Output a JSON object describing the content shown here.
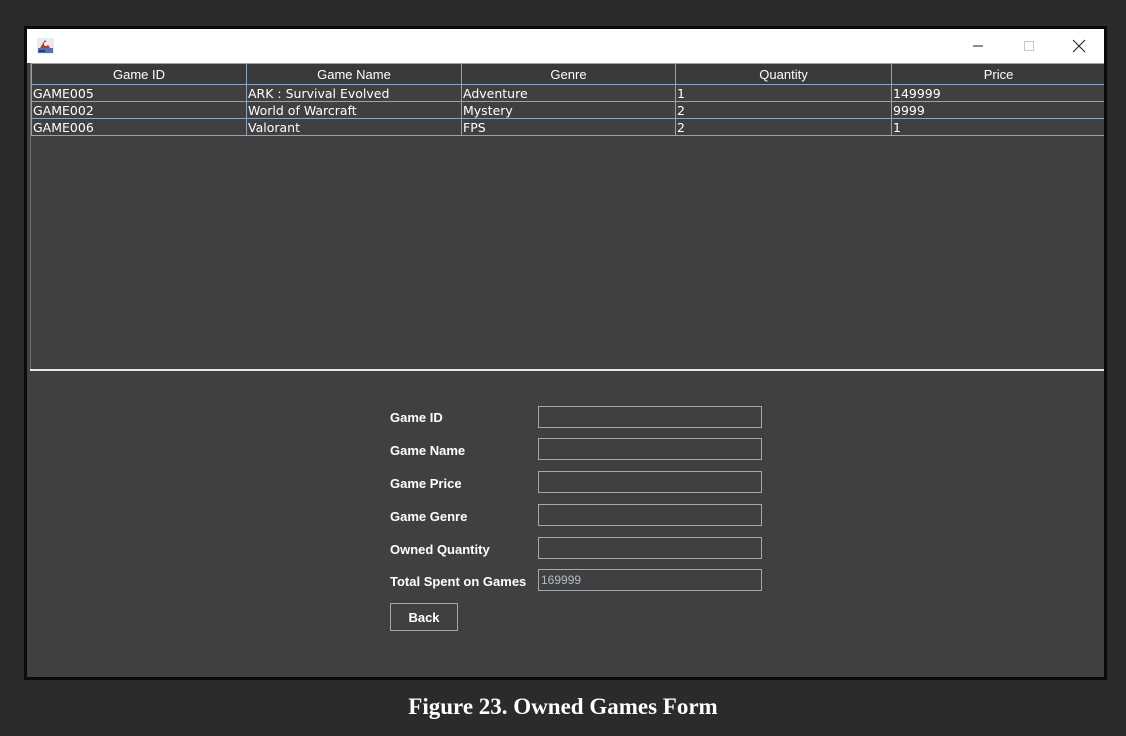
{
  "window": {
    "controls": {
      "minimize_icon": "minimize-icon",
      "maximize_icon": "maximize-icon",
      "close_icon": "close-icon"
    }
  },
  "table": {
    "columns": [
      "Game ID",
      "Game Name",
      "Genre",
      "Quantity",
      "Price"
    ],
    "rows": [
      [
        "GAME005",
        "ARK : Survival Evolved",
        "Adventure",
        "1",
        "149999"
      ],
      [
        "GAME002",
        "World of Warcraft",
        "Mystery",
        "2",
        "9999"
      ],
      [
        "GAME006",
        "Valorant",
        "FPS",
        "2",
        "1"
      ]
    ]
  },
  "form": {
    "game_id_label": "Game ID",
    "game_name_label": "Game Name",
    "game_price_label": "Game Price",
    "game_genre_label": "Game Genre",
    "owned_quantity_label": "Owned Quantity",
    "total_spent_label": "Total Spent on Games",
    "game_id_value": "",
    "game_name_value": "",
    "game_price_value": "",
    "game_genre_value": "",
    "owned_quantity_value": "",
    "total_spent_value": "169999",
    "back_label": "Back"
  },
  "caption": "Figure 23. Owned Games Form"
}
